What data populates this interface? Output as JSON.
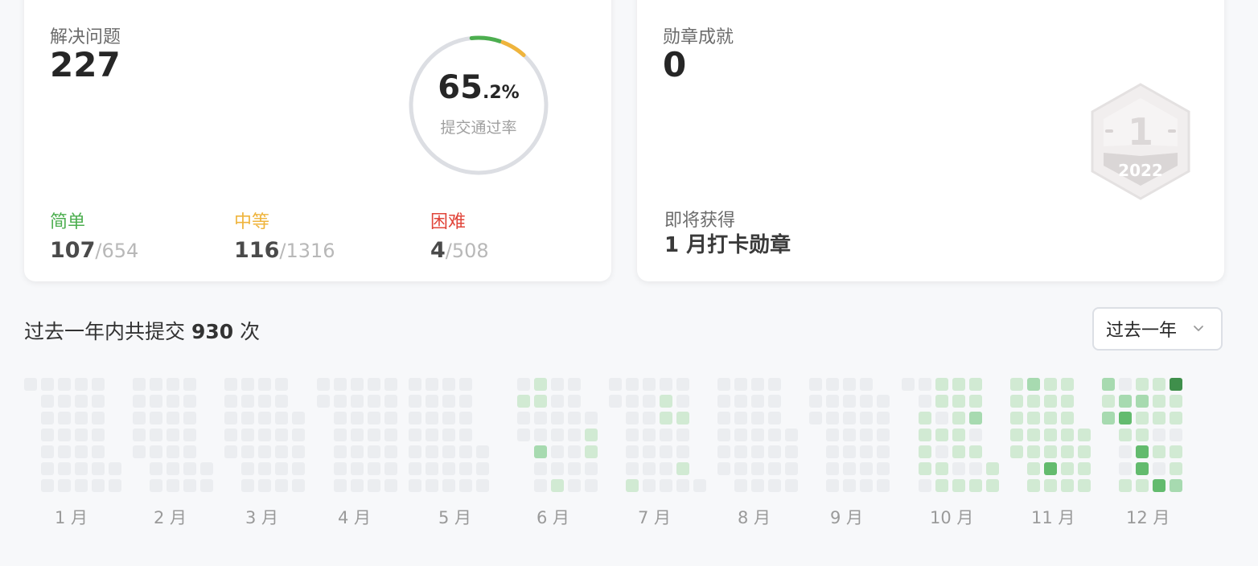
{
  "solved": {
    "label": "解决问题",
    "count": "227",
    "rate_int": "65",
    "rate_dec": ".2%",
    "rate_label": "提交通过率",
    "ring_fraction": 0.652,
    "easy": {
      "label": "简单",
      "solved": "107",
      "total": "654",
      "color": "#4cae4f"
    },
    "medium": {
      "label": "中等",
      "solved": "116",
      "total": "1316",
      "color": "#efb43c"
    },
    "hard": {
      "label": "困难",
      "solved": "4",
      "total": "508",
      "color": "#e1453a"
    }
  },
  "badges": {
    "label": "勋章成就",
    "count": "0",
    "next_label": "即将获得",
    "next_name": "1 月打卡勋章",
    "badge_icon": "calendar-badge-icon",
    "badge_month": "1",
    "badge_year": "2022"
  },
  "submissions": {
    "prefix": "过去一年内共提交",
    "count": "930",
    "suffix": "次",
    "range": "过去一年",
    "month_labels": [
      "1 月",
      "2 月",
      "3 月",
      "4 月",
      "5 月",
      "6 月",
      "7 月",
      "8 月",
      "9 月",
      "10 月",
      "11 月",
      "12 月"
    ],
    "level_colors": [
      "#ebedf0",
      "#d1ead3",
      "#a7dab0",
      "#63bb6e",
      "#3f8f4b"
    ],
    "months": [
      {
        "start": 6,
        "days": [
          0,
          0,
          0,
          0,
          0,
          0,
          0,
          0,
          0,
          0,
          0,
          0,
          0,
          0,
          0,
          0,
          0,
          0,
          0,
          0,
          0,
          0,
          0,
          0,
          0,
          0,
          0,
          0,
          0,
          0,
          0
        ]
      },
      {
        "start": 2,
        "days": [
          0,
          0,
          0,
          0,
          0,
          0,
          0,
          0,
          0,
          0,
          0,
          0,
          0,
          0,
          0,
          0,
          0,
          0,
          0,
          0,
          0,
          0,
          0,
          0,
          0,
          0,
          0,
          0
        ]
      },
      {
        "start": 2,
        "days": [
          0,
          0,
          0,
          0,
          0,
          0,
          0,
          0,
          0,
          0,
          0,
          0,
          0,
          0,
          0,
          0,
          0,
          0,
          0,
          0,
          0,
          0,
          0,
          0,
          0,
          0,
          0,
          0,
          0,
          0,
          0
        ]
      },
      {
        "start": 5,
        "days": [
          0,
          0,
          0,
          0,
          0,
          0,
          0,
          0,
          0,
          0,
          0,
          0,
          0,
          0,
          0,
          0,
          0,
          0,
          0,
          0,
          0,
          0,
          0,
          0,
          0,
          0,
          0,
          0,
          0,
          0
        ]
      },
      {
        "start": 0,
        "days": [
          0,
          0,
          0,
          0,
          0,
          0,
          0,
          0,
          0,
          0,
          0,
          0,
          0,
          0,
          0,
          0,
          0,
          0,
          0,
          0,
          0,
          0,
          0,
          0,
          0,
          0,
          0,
          0,
          0,
          0,
          0
        ]
      },
      {
        "start": 3,
        "days": [
          0,
          0,
          1,
          0,
          0,
          0,
          2,
          0,
          0,
          1,
          1,
          1,
          0,
          0,
          0,
          0,
          0,
          0,
          0,
          0,
          0,
          0,
          0,
          0,
          0,
          0,
          0,
          1,
          1,
          0
        ]
      },
      {
        "start": 5,
        "days": [
          0,
          0,
          1,
          0,
          0,
          0,
          0,
          0,
          0,
          0,
          0,
          0,
          0,
          0,
          0,
          0,
          0,
          0,
          0,
          0,
          1,
          1,
          0,
          0,
          1,
          0,
          0,
          1,
          0,
          0,
          0
        ]
      },
      {
        "start": 1,
        "days": [
          0,
          0,
          0,
          0,
          0,
          0,
          0,
          0,
          0,
          0,
          0,
          0,
          0,
          0,
          0,
          0,
          0,
          0,
          0,
          0,
          0,
          0,
          0,
          0,
          0,
          0,
          0,
          0,
          0,
          0,
          0
        ]
      },
      {
        "start": 4,
        "days": [
          0,
          0,
          0,
          0,
          0,
          0,
          0,
          0,
          0,
          0,
          0,
          0,
          0,
          0,
          0,
          0,
          0,
          0,
          0,
          0,
          0,
          0,
          0,
          0,
          0,
          0,
          0,
          0,
          0,
          0
        ]
      },
      {
        "start": 6,
        "days": [
          0,
          0,
          1,
          1,
          1,
          1,
          0,
          0,
          1,
          1,
          0,
          1,
          0,
          1,
          1,
          1,
          0,
          1,
          1,
          1,
          1,
          1,
          1,
          0,
          1,
          0,
          2,
          1,
          1,
          1,
          1
        ]
      },
      {
        "start": 2,
        "days": [
          1,
          1,
          1,
          1,
          1,
          1,
          1,
          1,
          1,
          1,
          1,
          2,
          1,
          3,
          1,
          1,
          1,
          1,
          1,
          1,
          1,
          1,
          1,
          1,
          1,
          1,
          1,
          1,
          1,
          1
        ]
      },
      {
        "start": 4,
        "days": [
          2,
          1,
          2,
          1,
          0,
          0,
          1,
          3,
          2,
          0,
          1,
          3,
          3,
          1,
          1,
          2,
          1,
          3,
          0,
          1,
          0,
          1,
          1,
          1,
          2,
          1,
          1,
          0,
          1,
          1,
          4
        ]
      }
    ]
  }
}
